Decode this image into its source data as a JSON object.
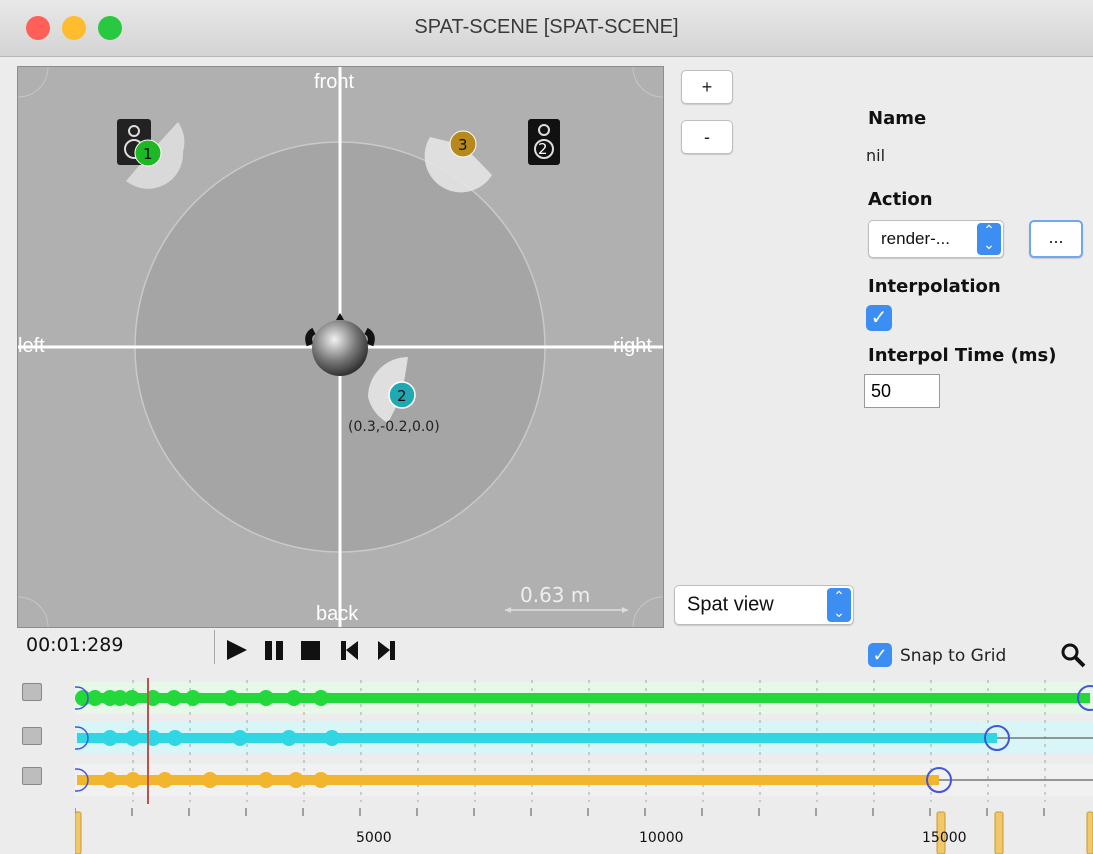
{
  "window": {
    "title": "SPAT-SCENE [SPAT-SCENE]",
    "traffic_lights": {
      "close": "#fe5f57",
      "minimize": "#febc2e",
      "zoom": "#28c840"
    }
  },
  "spat": {
    "labels": {
      "front": "front",
      "back": "back",
      "left": "left",
      "right": "right"
    },
    "sources": [
      {
        "label": "1",
        "color": "#1db823"
      },
      {
        "label": "2",
        "color": "#21a9b3",
        "coords": "(0.3,-0.2,0.0)"
      },
      {
        "label": "3",
        "color": "#b7891c"
      }
    ],
    "speakers": [
      "1",
      "2"
    ],
    "scale": "0.63 m"
  },
  "zoom": {
    "plus": "+",
    "minus": "-"
  },
  "props": {
    "name_label": "Name",
    "name_value": "nil",
    "action_label": "Action",
    "action_value": "render-...",
    "action_more": "...",
    "interpolation_label": "Interpolation",
    "interpolation_checked": true,
    "interpol_time_label": "Interpol Time (ms)",
    "interpol_time_value": "50"
  },
  "view_select": {
    "value": "Spat view"
  },
  "transport": {
    "time": "00:01:289"
  },
  "snap": {
    "label": "Snap to Grid",
    "checked": true
  },
  "timeline": {
    "tick_labels": [
      "5000",
      "10000",
      "15000"
    ],
    "tracks": [
      {
        "color": "#23d83b",
        "bg": "#e8f8e8"
      },
      {
        "color": "#2fd6e3",
        "bg": "#d8f6f8"
      },
      {
        "color": "#f1b52e",
        "bg": "#f1f1f1"
      }
    ],
    "playhead_color": "#c0504d"
  }
}
